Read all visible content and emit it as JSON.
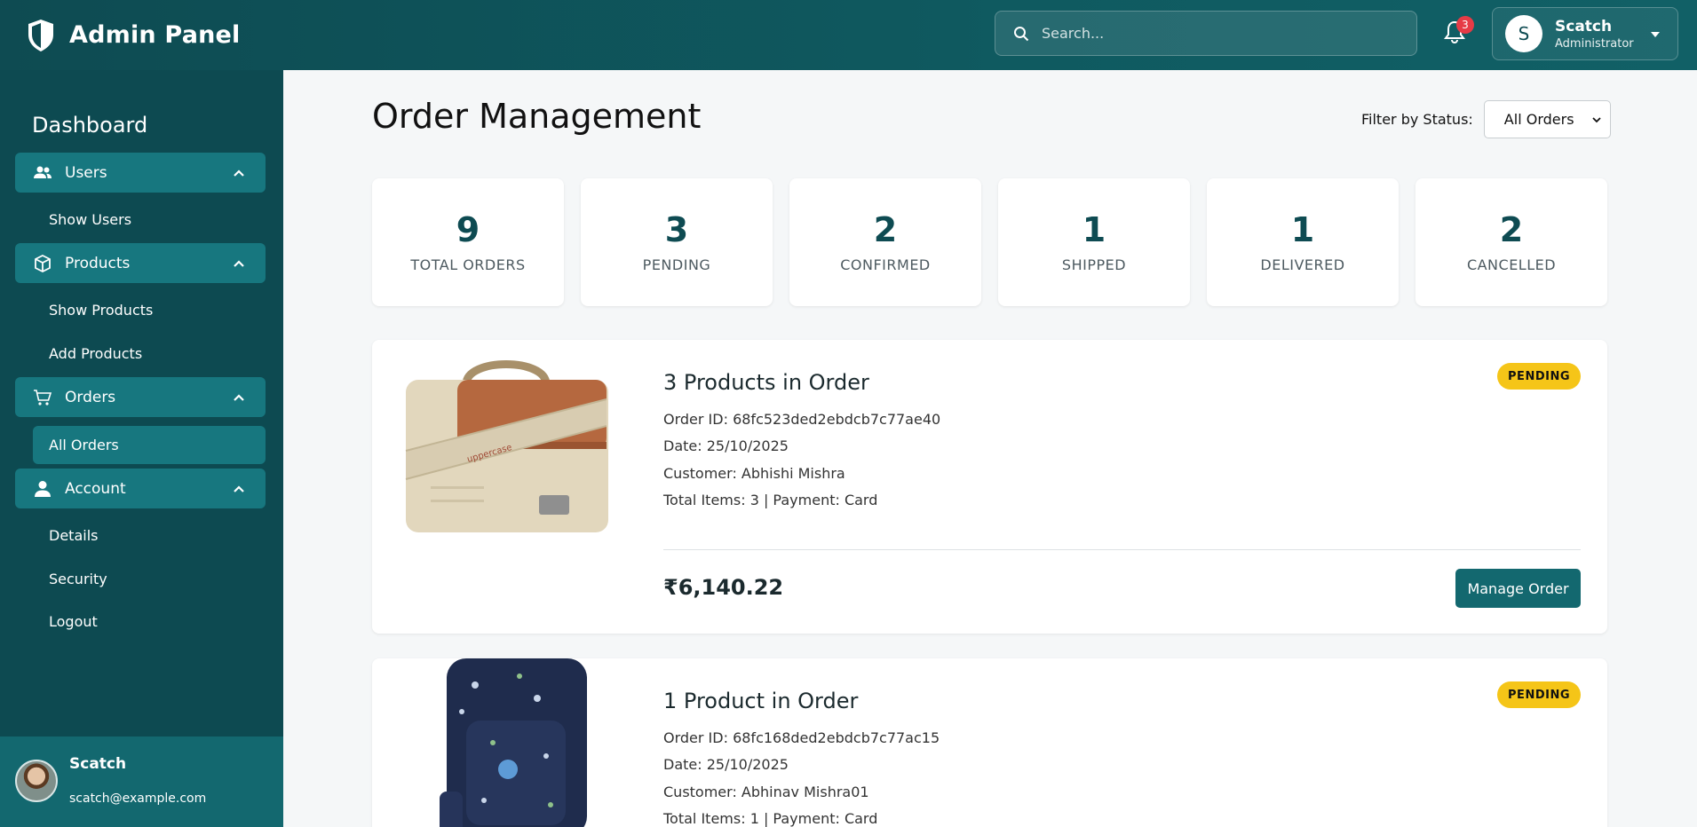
{
  "app": {
    "title": "Admin Panel"
  },
  "search": {
    "placeholder": "Search..."
  },
  "notifications": {
    "count": "3"
  },
  "user": {
    "initial": "S",
    "name": "Scatch",
    "role": "Administrator"
  },
  "sidebar": {
    "heading": "Dashboard",
    "sections": [
      {
        "label": "Users",
        "icon": "users-icon",
        "items": [
          "Show Users"
        ]
      },
      {
        "label": "Products",
        "icon": "box-icon",
        "items": [
          "Show Products",
          "Add Products"
        ]
      },
      {
        "label": "Orders",
        "icon": "cart-icon",
        "items": [
          "All Orders"
        ],
        "active_item": "All Orders"
      },
      {
        "label": "Account",
        "icon": "person-icon",
        "items": [
          "Details",
          "Security",
          "Logout"
        ]
      }
    ],
    "profile": {
      "name": "Scatch",
      "email": "scatch@example.com"
    }
  },
  "main": {
    "title": "Order Management",
    "filter": {
      "label": "Filter by Status:",
      "selected": "All Orders"
    },
    "stats": [
      {
        "value": "9",
        "label": "TOTAL ORDERS"
      },
      {
        "value": "3",
        "label": "PENDING"
      },
      {
        "value": "2",
        "label": "CONFIRMED"
      },
      {
        "value": "1",
        "label": "SHIPPED"
      },
      {
        "value": "1",
        "label": "DELIVERED"
      },
      {
        "value": "2",
        "label": "CANCELLED"
      }
    ],
    "orders": [
      {
        "title": "3 Products in Order",
        "status": "PENDING",
        "order_id": "Order ID: 68fc523ded2ebdcb7c77ae40",
        "date": "Date: 25/10/2025",
        "customer": "Customer: Abhishi Mishra",
        "items": "Total Items: 3 | Payment: Card",
        "total": "₹6,140.22",
        "button": "Manage Order",
        "image_text": "uppercase"
      },
      {
        "title": "1 Product in Order",
        "status": "PENDING",
        "order_id": "Order ID: 68fc168ded2ebdcb7c77ac15",
        "date": "Date: 25/10/2025",
        "customer": "Customer: Abhinav Mishra01",
        "items": "Total Items: 1 | Payment: Card"
      }
    ]
  },
  "colors": {
    "topbar": "#0e4b52",
    "sidebar": "#0d4a51",
    "accent": "#17777f",
    "pending": "#f5c518",
    "badge": "#e63b46"
  }
}
